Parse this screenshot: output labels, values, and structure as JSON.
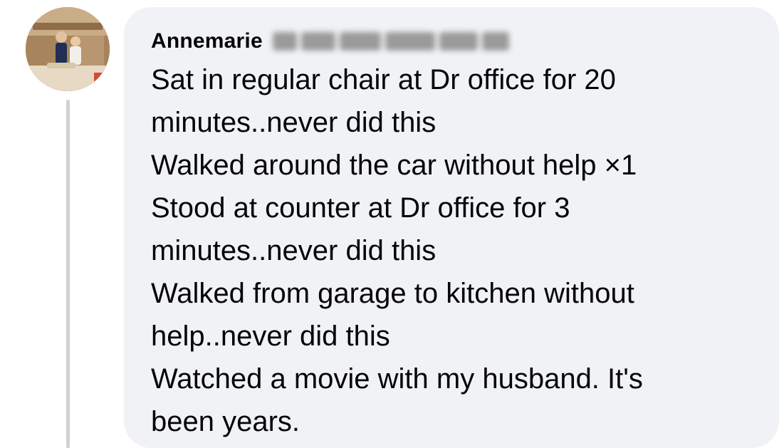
{
  "comment": {
    "author": "Annemarie",
    "author_surname_redacted": true,
    "lines": [
      "Sat in regular chair at Dr office for 20",
      "minutes..never did this",
      "Walked around the car without help ×1",
      "Stood at counter at Dr office for 3",
      "minutes..never did this",
      "Walked from garage to kitchen without",
      "help..never did this",
      "Watched a movie with my husband. It's",
      "been years."
    ]
  },
  "colors": {
    "bubble_background": "#f0f2f5",
    "text": "#050505",
    "thread_line": "#cfd1d6"
  },
  "icons": {
    "avatar": "profile-photo"
  }
}
